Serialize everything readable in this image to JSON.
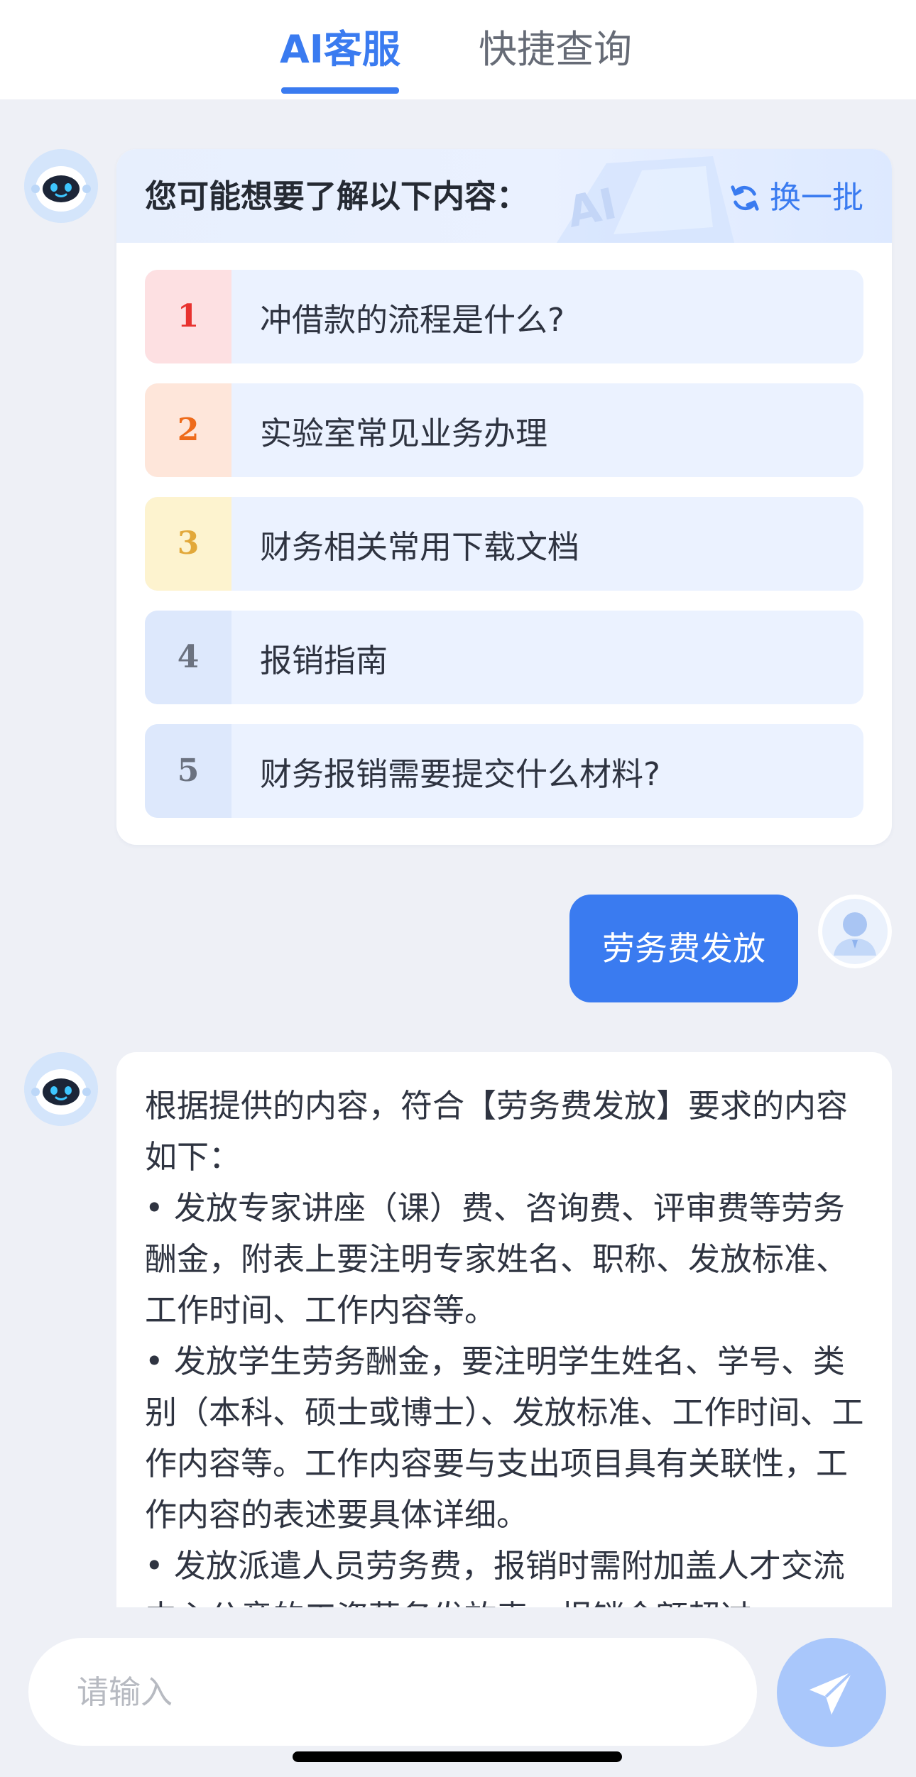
{
  "tabs": {
    "active": "AI客服",
    "other": "快捷查询"
  },
  "suggestions": {
    "title": "您可能想要了解以下内容：",
    "refresh_label": "换一批",
    "items": [
      {
        "num": "1",
        "text": "冲借款的流程是什么?",
        "num_color": "#e8322f",
        "num_bg": "#fde0e2"
      },
      {
        "num": "2",
        "text": "实验室常见业务办理",
        "num_color": "#ee6b1b",
        "num_bg": "#fee6da"
      },
      {
        "num": "3",
        "text": "财务相关常用下载文档",
        "num_color": "#e2a83a",
        "num_bg": "#fdf3cf"
      },
      {
        "num": "4",
        "text": "报销指南",
        "num_color": "#6b7280",
        "num_bg": "#dde8fc"
      },
      {
        "num": "5",
        "text": "财务报销需要提交什么材料?",
        "num_color": "#6b7280",
        "num_bg": "#dde8fc"
      }
    ]
  },
  "user_message": "劳务费发放",
  "answer": {
    "lines": [
      "根据提供的内容，符合【劳务费发放】要求的内容如下：",
      "• 发放专家讲座（课）费、咨询费、评审费等劳务酬金，附表上要注明专家姓名、职称、发放标准、工作时间、工作内容等。",
      "• 发放学生劳务酬金，要注明学生姓名、学号、类别（本科、硕士或博士）、发放标准、工作时间、工作内容等。工作内容要与支出项目具有关联性，工作内容的表述要具体详细。",
      "• 发放派遣人员劳务费，报销时需附加盖人才交流中心公章的工资薪务发放表，报销金额超过"
    ]
  },
  "input": {
    "placeholder": "请输入"
  },
  "colors": {
    "accent": "#3a7bf0",
    "page_bg": "#eef0f6",
    "send_button": "#a9c7fb"
  },
  "icons": {
    "bot_avatar": "robot-avatar-icon",
    "user_avatar": "user-avatar-icon",
    "refresh": "refresh-icon",
    "send": "paper-plane-icon"
  }
}
